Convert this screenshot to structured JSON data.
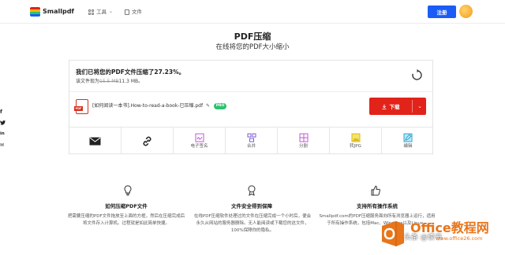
{
  "header": {
    "logo_text": "Smallpdf",
    "nav_tools": "工具",
    "nav_files": "文件",
    "register_button": "注册"
  },
  "social": [
    "f",
    "t",
    "in",
    "✉"
  ],
  "page": {
    "title": "PDF压缩",
    "subtitle": "在线将您的PDF大小缩小"
  },
  "result": {
    "message": "我们已将您的PDF文件压缩了27.23%。",
    "size_prefix": "该文件现为",
    "size_old": "15.5 MB",
    "size_new": "11.3 MB。",
    "file_name": "[如何阅读一本书].How-to-read-a-book-已压缩.pdf",
    "pro_badge": "PRO",
    "pdf_tag": "PDF",
    "download_button": "下载",
    "compression_percent": 27.23
  },
  "actions": [
    {
      "name": "email",
      "label": "",
      "icon": "envelope-icon"
    },
    {
      "name": "link",
      "label": "",
      "icon": "link-icon"
    },
    {
      "name": "esign",
      "label": "电子签名",
      "icon": "esign-icon"
    },
    {
      "name": "merge",
      "label": "合并",
      "icon": "merge-icon"
    },
    {
      "name": "split",
      "label": "分割",
      "icon": "split-icon"
    },
    {
      "name": "to-jpg",
      "label": "转JPG",
      "icon": "jpg-icon"
    },
    {
      "name": "edit",
      "label": "编辑",
      "icon": "edit-icon"
    }
  ],
  "features": [
    {
      "title": "如何压缩PDF文件",
      "text": "把需要压缩的PDF文件拖放至上面的方框，然后在压缩完成后将文件存入计算机。过程就是如此简单快捷。"
    },
    {
      "title": "文件安全得到保障",
      "text": "在线PDF压缩软件处理过的文件在压缩完成一个小时后，便会永久从网站的服务器删除。无人能阅读或下载您的这文件，100%保障你的隐私。"
    },
    {
      "title": "支持所有操作系统",
      "text": "Smallpdf.com的PDF压缩服务面向所有浏览器上运行，适用于所有操作系统，包括Mac、Windows以及Linux。"
    }
  ],
  "watermark": {
    "brand": "Office教程网",
    "url": "www.office26.com",
    "head": "头条 @读书"
  },
  "colors": {
    "accent_blue": "#1a5cf5",
    "download_red": "#e2231a",
    "pro_green": "#2bc36f"
  }
}
